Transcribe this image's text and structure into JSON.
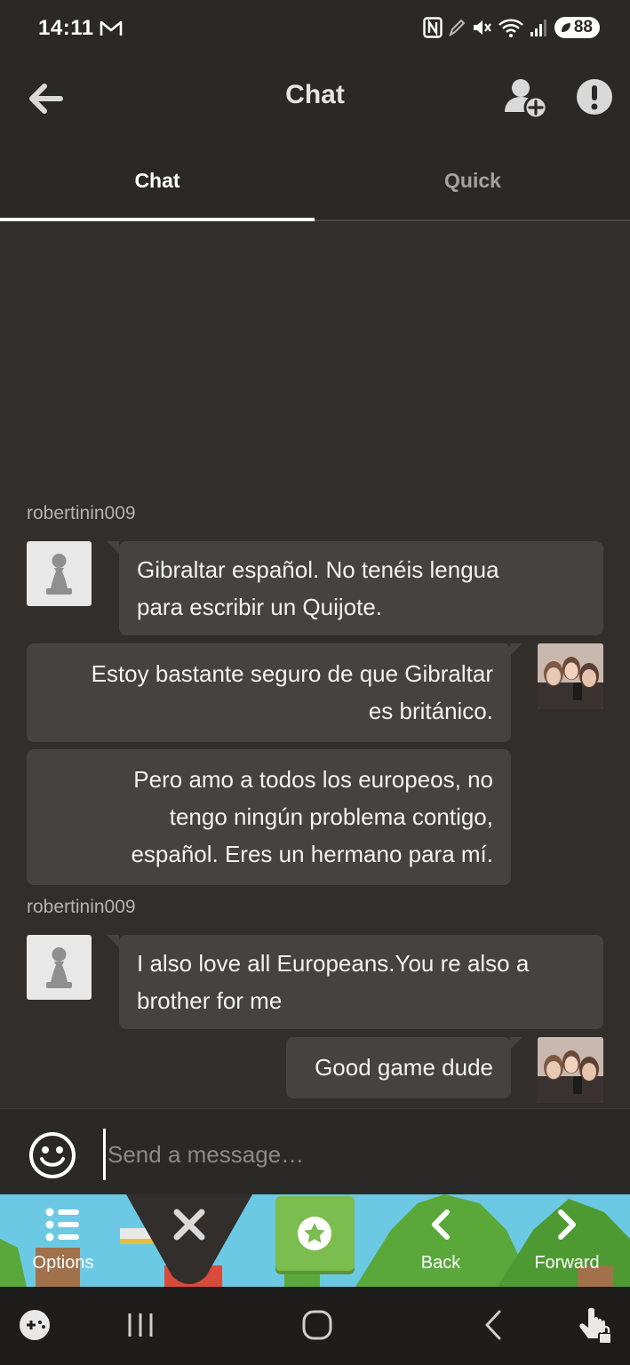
{
  "status_bar": {
    "time": "14:11",
    "battery": "88"
  },
  "header": {
    "title": "Chat"
  },
  "tabs": [
    {
      "label": "Chat",
      "active": true
    },
    {
      "label": "Quick",
      "active": false
    }
  ],
  "messages": [
    {
      "username": "robertinin009",
      "text": "Gibraltar español. No tenéis lengua para escribir un Quijote.",
      "lines": [
        "Gibraltar español. No tenéis lengua",
        "para escribir un Quijote."
      ]
    },
    {
      "text": "Estoy bastante seguro de que Gibraltar es británico.",
      "lines": [
        "Estoy bastante seguro de que Gibraltar",
        "es británico."
      ]
    },
    {
      "text": "Pero amo a todos los europeos, no tengo ningún problema contigo, español. Eres un hermano para mí.",
      "lines": [
        "Pero amo a todos los europeos, no",
        "tengo ningún problema contigo,",
        "español. Eres un hermano para mí."
      ]
    },
    {
      "username": "robertinin009",
      "text": "I also love all Europeans.You re also a brother for me",
      "lines": [
        "I also love all Europeans.You re also a",
        "brother for me"
      ]
    },
    {
      "text": "Good game dude",
      "lines": [
        "Good game dude"
      ]
    }
  ],
  "composer": {
    "placeholder": "Send a message…"
  },
  "game_bar": {
    "options_label": "Options",
    "back_label": "Back",
    "forward_label": "Forward"
  },
  "colors": {
    "background": "#312e2b",
    "bubble": "#454240",
    "header": "#2b2928",
    "accent_green": "#7bbd4e"
  }
}
